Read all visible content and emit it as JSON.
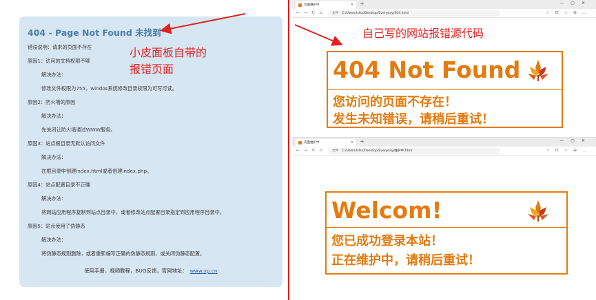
{
  "left_panel": {
    "title": "404 - Page Not Found 未找到",
    "lines": [
      "错误说明：请求的页面不存在",
      "原因1：访问的文档权限不够",
      "解决办法：",
      "修改文件权限为755，windos系统修改目录权限为可写可读。",
      "原因2：防火墙的原因",
      "解决办法：",
      "先关闭让防火墙通过WWW服务。",
      "原因3：站点根目录无默认访问文件",
      "解决办法：",
      "在根目录中创建index.html或者创建index.php。",
      "原因4：站点配置目录不正确",
      "解决办法：",
      "将网站应用程序复制到站点目录中，或者修改站点配置目录指定到应用程序目录中。",
      "原因5：站点使用了伪静态",
      "解决办法：",
      "将伪静态规则删除，或者重新编写正确的伪静态规则，或关闭伪静态配置。"
    ],
    "footer_text": "使用手册，视频教程，BUG反馈，官网地址：",
    "footer_link": "www.xp.cn"
  },
  "annotations": {
    "left_line1": "小皮面板自带的",
    "left_line2": "报错页面",
    "right": "自己写的网站报错源代码"
  },
  "browser_top": {
    "tab_title": "页面维护中",
    "address_label": "文件",
    "url": "C:/Users/lxfsz/Desktop/Everyday/404.html",
    "heading": "404 Not Found",
    "line1": "您访问的页面不存在！",
    "line2": "发生未知错误，请稍后重试！"
  },
  "browser_bottom": {
    "tab_title": "页面维护中",
    "address_label": "文件",
    "url": "C:/Users/lxfsz/Desktop/Everyday/维护中.html",
    "heading": "Welcom!",
    "line1": "您已成功登录本站！",
    "line2": "正在维护中，请稍后重试！"
  },
  "colors": {
    "panel_bg": "#d7e6f3",
    "panel_title": "#4a7cab",
    "annotation_red": "#e42020",
    "accent_orange": "#e37b10"
  },
  "icons": [
    "leaf-logo-icon",
    "back-icon",
    "forward-icon",
    "refresh-icon",
    "home-icon",
    "info-icon",
    "close-icon",
    "plus-icon"
  ]
}
